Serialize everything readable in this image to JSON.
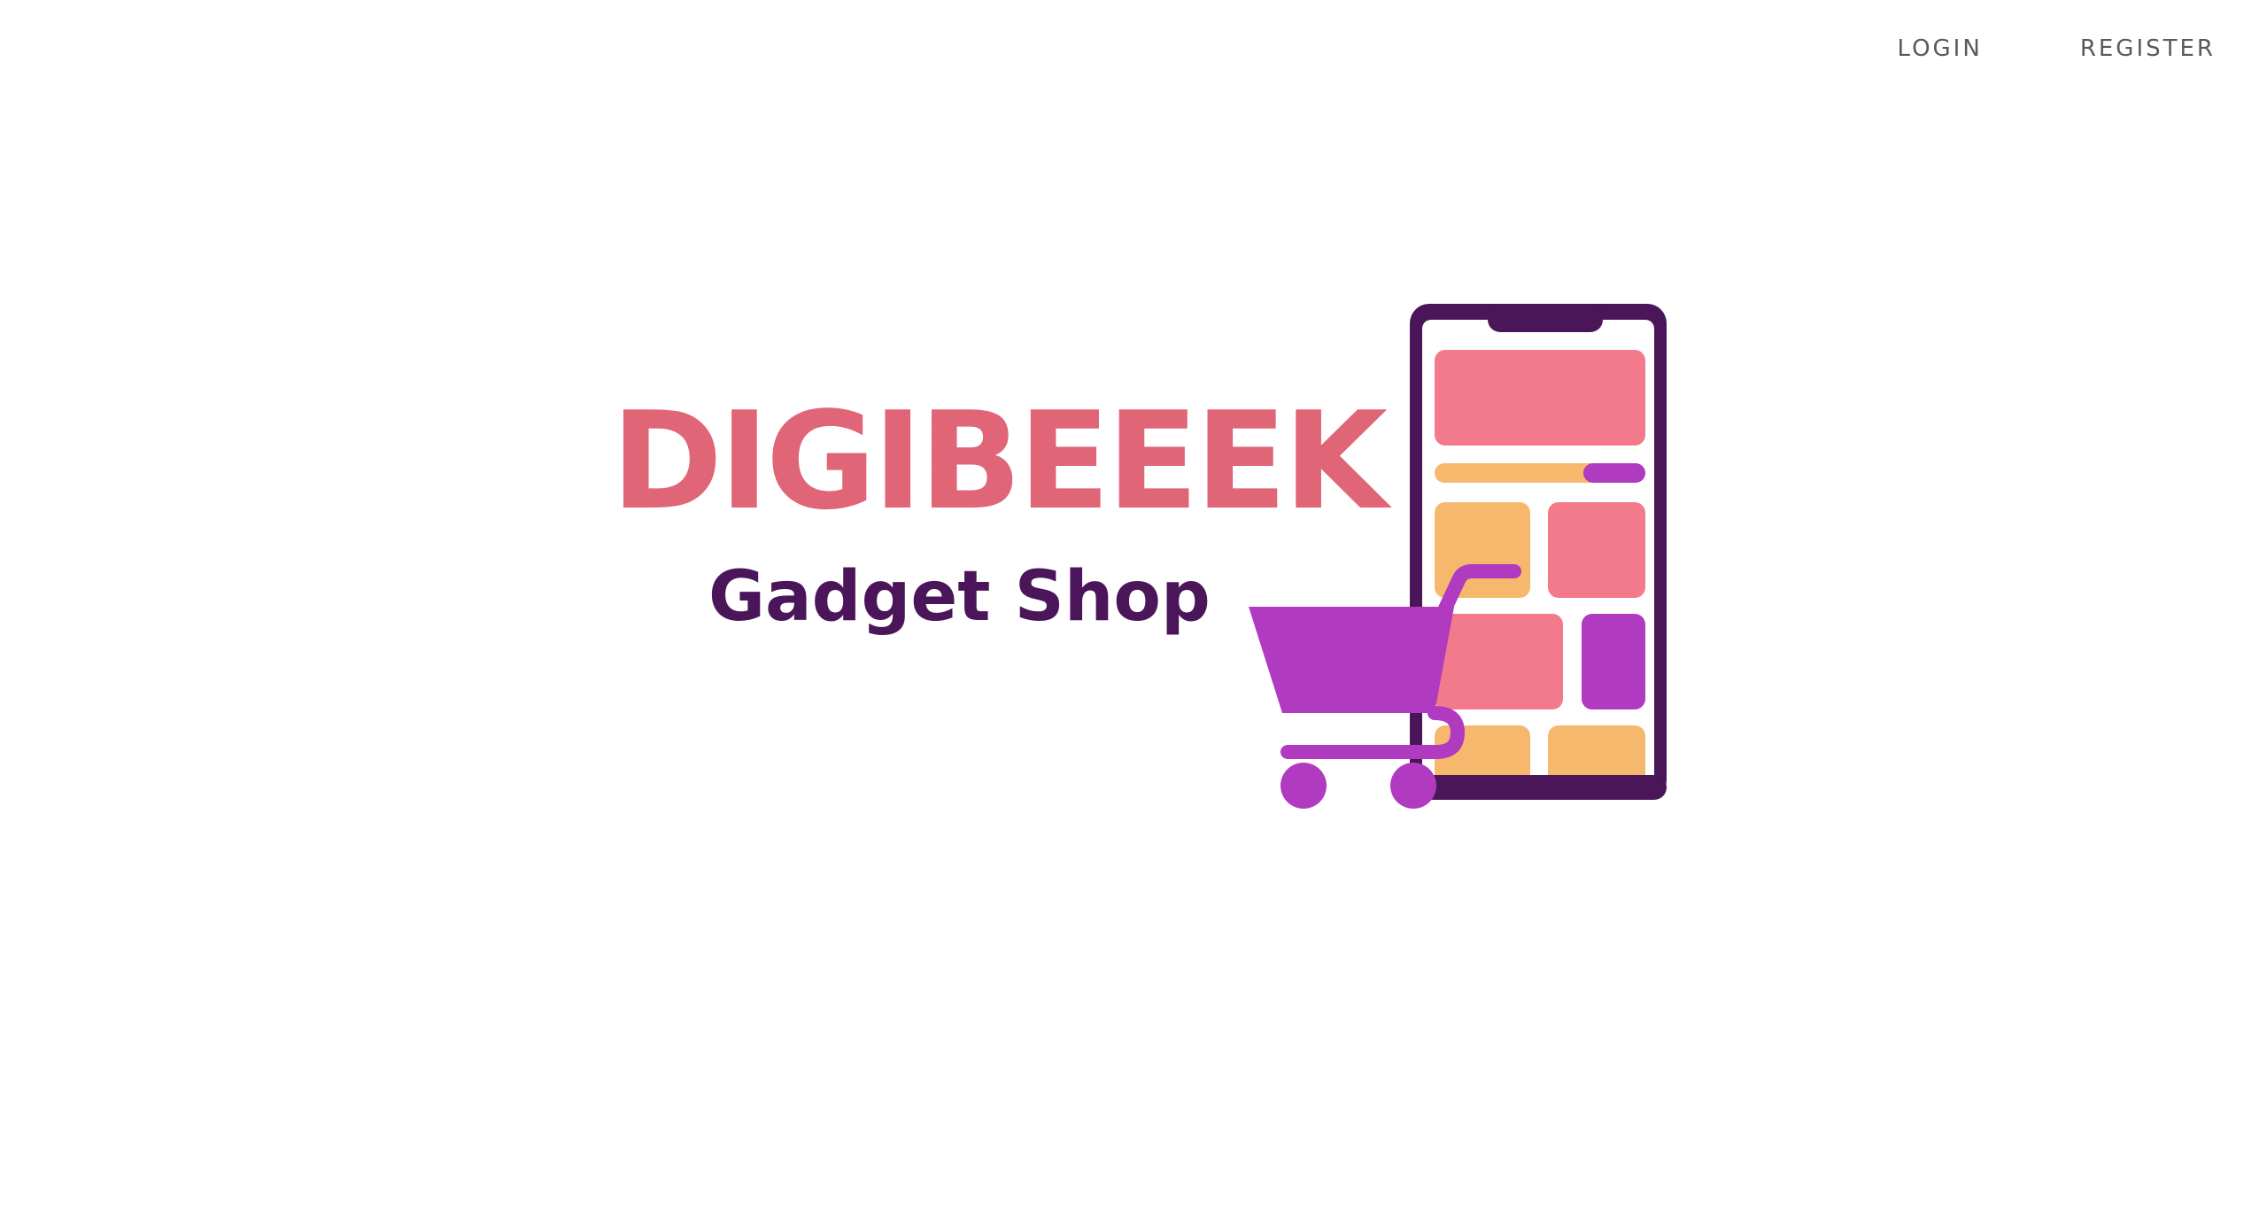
{
  "nav": {
    "login_label": "LOGIN",
    "register_label": "REGISTER"
  },
  "logo": {
    "brand_name": "DIGIBEEEK",
    "tagline": "Gadget Shop",
    "icons": [
      "smartphone-icon",
      "shopping-cart-icon"
    ]
  },
  "colors": {
    "brand_pink": "#e06577",
    "brand_purple_dark": "#4b1659",
    "cart_purple": "#b03ac0",
    "tile_pink": "#f27a8a",
    "tile_orange": "#f6b86c",
    "nav_text": "#555b60"
  }
}
